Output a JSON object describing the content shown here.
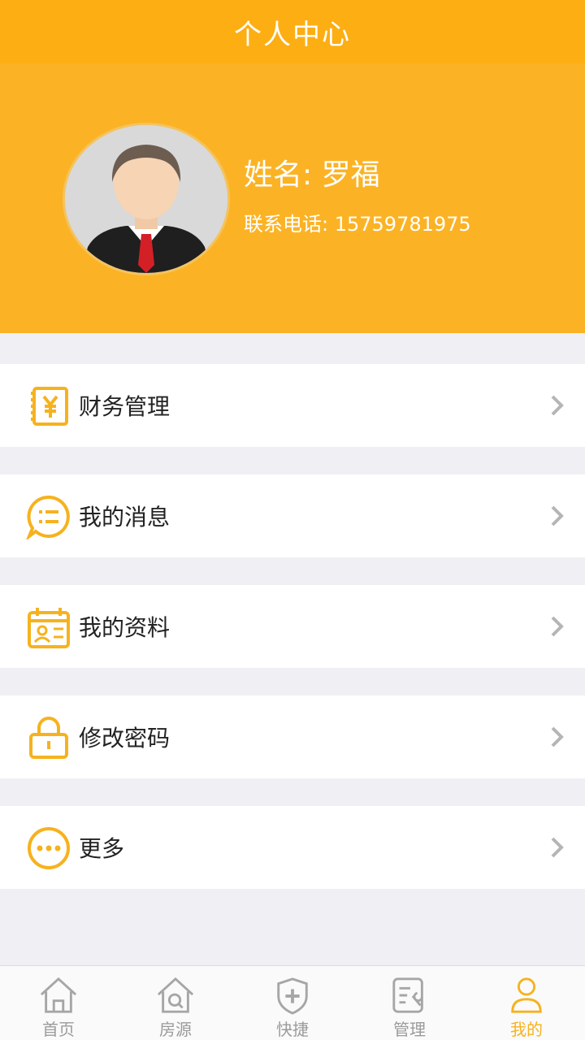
{
  "header": {
    "title": "个人中心"
  },
  "profile": {
    "name": "姓名: 罗福",
    "phone": "联系电话: 15759781975"
  },
  "colors": {
    "brand": "#fdae13",
    "icon": "#f6b21e",
    "background": "#efeff4"
  },
  "menu": [
    {
      "label": "财务管理",
      "icon": "finance-icon"
    },
    {
      "label": "我的消息",
      "icon": "message-icon"
    },
    {
      "label": "我的资料",
      "icon": "profile-card-icon"
    },
    {
      "label": "修改密码",
      "icon": "lock-icon"
    },
    {
      "label": "更多",
      "icon": "more-icon"
    }
  ],
  "tabs": [
    {
      "label": "首页",
      "icon": "home-icon",
      "active": false
    },
    {
      "label": "房源",
      "icon": "house-search-icon",
      "active": false
    },
    {
      "label": "快捷",
      "icon": "shield-plus-icon",
      "active": false
    },
    {
      "label": "管理",
      "icon": "manage-icon",
      "active": false
    },
    {
      "label": "我的",
      "icon": "user-icon",
      "active": true
    }
  ]
}
